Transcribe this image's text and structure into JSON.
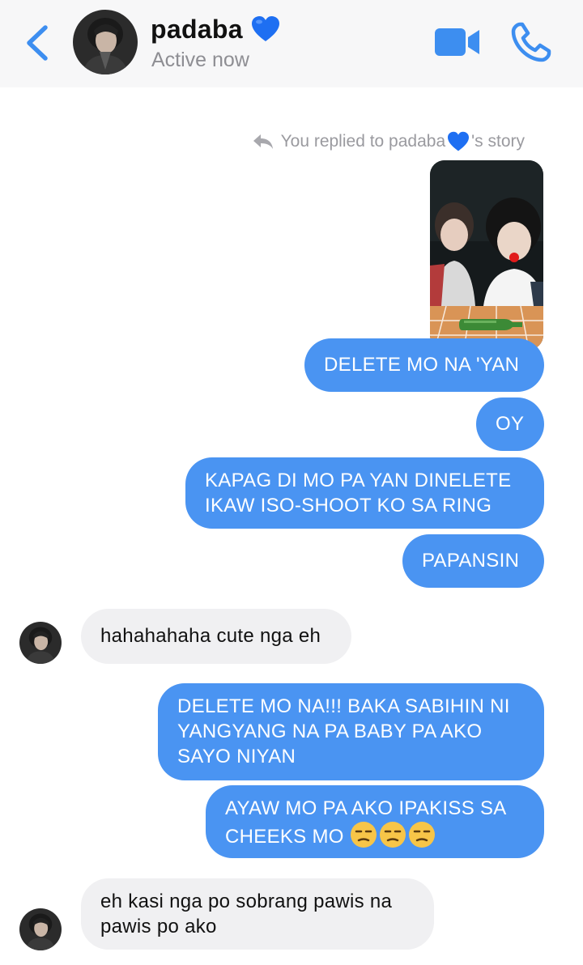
{
  "header": {
    "contact_name": "padaba",
    "status": "Active now"
  },
  "thread": {
    "reply_prefix": "You replied to padaba",
    "reply_suffix": "'s story",
    "messages": [
      {
        "from": "me",
        "text": "DELETE MO NA 'YAN"
      },
      {
        "from": "me",
        "text": "OY"
      },
      {
        "from": "me",
        "line1": "KAPAG DI MO PA YAN DINELETE",
        "line2": "IKAW ISO-SHOOT KO SA RING"
      },
      {
        "from": "me",
        "text": "PAPANSIN"
      },
      {
        "from": "them",
        "text": "hahahahaha cute nga eh"
      },
      {
        "from": "me",
        "line1": "DELETE MO NA!!! BAKA SABIHIN NI",
        "line2": "YANGYANG NA PA BABY PA AKO",
        "line3": "SAYO NIYAN"
      },
      {
        "from": "me",
        "line1": "AYAW MO PA AKO IPAKISS SA",
        "line2": "CHEEKS MO"
      },
      {
        "from": "them",
        "line1": "eh kasi nga po sobrang pawis na",
        "line2": "pawis po ako"
      }
    ]
  },
  "colors": {
    "accent": "#3d8ef0",
    "outgoing_bubble": "#4a94f2",
    "incoming_bubble": "#f0f0f2",
    "heart": "#1e6ff2"
  },
  "icons": {
    "back": "chevron-left-icon",
    "video": "video-camera-icon",
    "call": "phone-icon",
    "reply": "reply-arrow-icon",
    "heart": "blue-heart-emoji",
    "unamused": "unamused-face-emoji"
  }
}
